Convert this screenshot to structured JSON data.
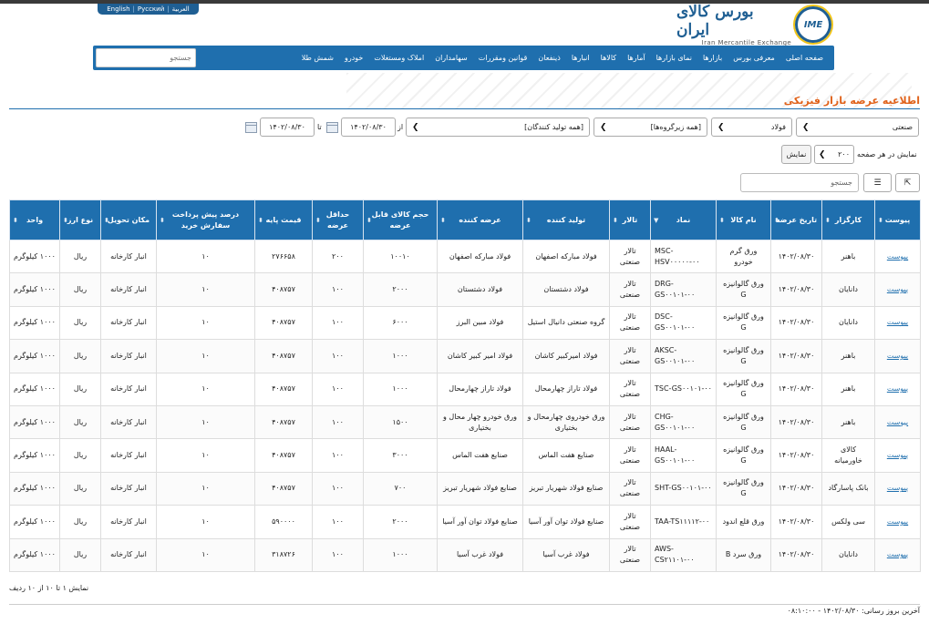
{
  "lang": {
    "arabic": "العربية",
    "russian": "Русский",
    "english": "English",
    "sep": "|"
  },
  "logo": {
    "emblem": "IME",
    "fa": "بورس کالای ایران",
    "en": "Iran Mercantile Exchange"
  },
  "nav": {
    "items": [
      "صفحه اصلی",
      "معرفی بورس",
      "بازارها",
      "نمای بازارها",
      "آمارها",
      "کالاها",
      "انبارها",
      "ذینفعان",
      "قوانین ومقررات",
      "سهامداران",
      "املاک ومستغلات",
      "خودرو",
      "شمش طلا"
    ],
    "search_placeholder": "جستجو"
  },
  "page_title": "اطلاعیه عرضه بازار فیزیکی",
  "filters": {
    "market": "صنعتی",
    "group": "فولاد",
    "subgroup": "[همه زیرگروه‌ها]",
    "producer": "[همه تولید کنندگان]",
    "from_label": "از",
    "from_date": "۱۴۰۲/۰۸/۳۰",
    "to_label": "تا",
    "to_date": "۱۴۰۲/۰۸/۳۰",
    "per_page_label": "نمایش در هر صفحه",
    "per_page": "۲۰۰",
    "show_button": "نمایش",
    "table_search_placeholder": "جستجو",
    "col_toggle": "☰",
    "export": "⇱"
  },
  "table": {
    "headers": [
      "پیوست",
      "کارگزار",
      "تاریخ عرضه",
      "نام کالا",
      "نماد",
      "تالار",
      "تولید کننده",
      "عرضه کننده",
      "حجم کالای قابل عرضه",
      "حداقل عرضه",
      "قیمت پایه",
      "درصد پیش پرداخت سفارش خرید",
      "مکان تحویل",
      "نوع ارز",
      "واحد"
    ],
    "rows": [
      [
        "پیوست",
        "باهنر",
        "۱۴۰۲/۰۸/۳۰",
        "ورق گرم خودرو",
        "MSC-HSV۰۰۰۰۰-۰۰",
        "تالار صنعتی",
        "فولاد مبارکه اصفهان",
        "فولاد مبارکه اصفهان",
        "۱۰۰۱۰",
        "۲۰۰",
        "۲۷۶۶۵۸",
        "۱۰",
        "انبار کارخانه",
        "ریال",
        "۱۰۰۰ کیلوگرم"
      ],
      [
        "پیوست",
        "دانایان",
        "۱۴۰۲/۰۸/۳۰",
        "ورق گالوانیزه G",
        "DRG-GS۰۰۱۰۱-۰۰",
        "تالار صنعتی",
        "فولاد دشتستان",
        "فولاد دشتستان",
        "۲۰۰۰",
        "۱۰۰",
        "۴۰۸۷۵۷",
        "۱۰",
        "انبار کارخانه",
        "ریال",
        "۱۰۰۰ کیلوگرم"
      ],
      [
        "پیوست",
        "دانایان",
        "۱۴۰۲/۰۸/۳۰",
        "ورق گالوانیزه G",
        "DSC-GS۰۰۱۰۱-۰۰",
        "تالار صنعتی",
        "گروه صنعتی دانیال استیل",
        "فولاد مبین البرز",
        "۶۰۰۰",
        "۱۰۰",
        "۴۰۸۷۵۷",
        "۱۰",
        "انبار کارخانه",
        "ریال",
        "۱۰۰۰ کیلوگرم"
      ],
      [
        "پیوست",
        "باهنر",
        "۱۴۰۲/۰۸/۳۰",
        "ورق گالوانیزه G",
        "AKSC-GS۰۰۱۰۱-۰۰",
        "تالار صنعتی",
        "فولاد امیرکبیر کاشان",
        "فولاد امیر کبیر کاشان",
        "۱۰۰۰",
        "۱۰۰",
        "۴۰۸۷۵۷",
        "۱۰",
        "انبار کارخانه",
        "ریال",
        "۱۰۰۰ کیلوگرم"
      ],
      [
        "پیوست",
        "باهنر",
        "۱۴۰۲/۰۸/۳۰",
        "ورق گالوانیزه G",
        "TSC-GS۰۰۱۰۱-۰۰",
        "تالار صنعتی",
        "فولاد تاراز چهارمحال",
        "فولاد تاراز چهارمحال",
        "۱۰۰۰",
        "۱۰۰",
        "۴۰۸۷۵۷",
        "۱۰",
        "انبار کارخانه",
        "ریال",
        "۱۰۰۰ کیلوگرم"
      ],
      [
        "پیوست",
        "باهنر",
        "۱۴۰۲/۰۸/۳۰",
        "ورق گالوانیزه G",
        "CHG-GS۰۰۱۰۱-۰۰",
        "تالار صنعتی",
        "ورق خودروی چهارمحال و بختیاری",
        "ورق خودرو چهار محال و بختیاری",
        "۱۵۰۰",
        "۱۰۰",
        "۴۰۸۷۵۷",
        "۱۰",
        "انبار کارخانه",
        "ریال",
        "۱۰۰۰ کیلوگرم"
      ],
      [
        "پیوست",
        "کالای خاورمیانه",
        "۱۴۰۲/۰۸/۳۰",
        "ورق گالوانیزه G",
        "HAAL-GS۰۰۱۰۱-۰۰",
        "تالار صنعتی",
        "صنایع هفت الماس",
        "صنایع هفت الماس",
        "۳۰۰۰",
        "۱۰۰",
        "۴۰۸۷۵۷",
        "۱۰",
        "انبار کارخانه",
        "ریال",
        "۱۰۰۰ کیلوگرم"
      ],
      [
        "پیوست",
        "بانک پاسارگاد",
        "۱۴۰۲/۰۸/۳۰",
        "ورق گالوانیزه G",
        "SHT-GS۰۰۱۰۱-۰۰",
        "تالار صنعتی",
        "صنایع فولاد شهریار تبریز",
        "صنایع فولاد شهریار تبریز",
        "۷۰۰",
        "۱۰۰",
        "۴۰۸۷۵۷",
        "۱۰",
        "انبار کارخانه",
        "ریال",
        "۱۰۰۰ کیلوگرم"
      ],
      [
        "پیوست",
        "سی ولکس",
        "۱۴۰۲/۰۸/۳۰",
        "ورق قلع اندود",
        "TAA-TS۱۱۱۱۲-۰۰",
        "تالار صنعتی",
        "صنایع فولاد توان آور آسیا",
        "صنایع فولاد توان آور آسیا",
        "۲۰۰۰",
        "۱۰۰",
        "۵۹۰۰۰۰",
        "۱۰",
        "انبار کارخانه",
        "ریال",
        "۱۰۰۰ کیلوگرم"
      ],
      [
        "پیوست",
        "دانایان",
        "۱۴۰۲/۰۸/۳۰",
        "ورق سرد B",
        "AWS-CS۲۱۱۰۱-۰۰",
        "تالار صنعتی",
        "فولاد غرب آسیا",
        "فولاد غرب آسیا",
        "۱۰۰۰",
        "۱۰۰",
        "۳۱۸۷۲۶",
        "۱۰",
        "انبار کارخانه",
        "ریال",
        "۱۰۰۰ کیلوگرم"
      ]
    ]
  },
  "footer": {
    "showing": "نمایش ۱ تا ۱۰ از ۱۰ ردیف",
    "last_update": "آخرین بروز رسانی: ۱۴۰۲/۰۸/۳۰ - ۰۸:۱۰:۰۰"
  }
}
